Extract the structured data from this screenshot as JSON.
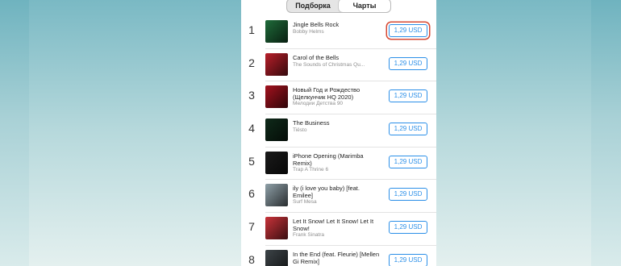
{
  "tabs": [
    {
      "label": "Подборка",
      "active": false
    },
    {
      "label": "Чарты",
      "active": true
    }
  ],
  "items": [
    {
      "rank": "1",
      "title": "Jingle Bells Rock",
      "artist": "Bobby Helms",
      "price": "1,29 USD",
      "highlighted": true,
      "art_color": "#1f6b3a"
    },
    {
      "rank": "2",
      "title": "Carol of the Bells",
      "artist": "The Sounds of Christmas Qu...",
      "price": "1,29 USD",
      "highlighted": false,
      "art_color": "#b81f2a"
    },
    {
      "rank": "3",
      "title": "Новый Год и Рождество (Щелкунчик HQ 2020)",
      "artist": "Мелодии Детства 90",
      "price": "1,29 USD",
      "highlighted": false,
      "art_color": "#a3121e"
    },
    {
      "rank": "4",
      "title": "The Business",
      "artist": "Tiësto",
      "price": "1,29 USD",
      "highlighted": false,
      "art_color": "#0f2a1a"
    },
    {
      "rank": "5",
      "title": "iPhone Opening (Marimba Remix)",
      "artist": "Trap A Thrine 6",
      "price": "1,29 USD",
      "highlighted": false,
      "art_color": "#1a1a1a"
    },
    {
      "rank": "6",
      "title": "ily (i love you baby) [feat. Emilee]",
      "artist": "Surf Mesa",
      "price": "1,29 USD",
      "highlighted": false,
      "art_color": "#8fa0a8"
    },
    {
      "rank": "7",
      "title": "Let It Snow! Let It Snow! Let It Snow!",
      "artist": "Frank Sinatra",
      "price": "1,29 USD",
      "highlighted": false,
      "art_color": "#c9333a"
    },
    {
      "rank": "8",
      "title": "In the End (feat. Fleurie) [Mellen Gi Remix]",
      "artist": "",
      "price": "1,29 USD",
      "highlighted": false,
      "art_color": "#3d4448"
    }
  ]
}
